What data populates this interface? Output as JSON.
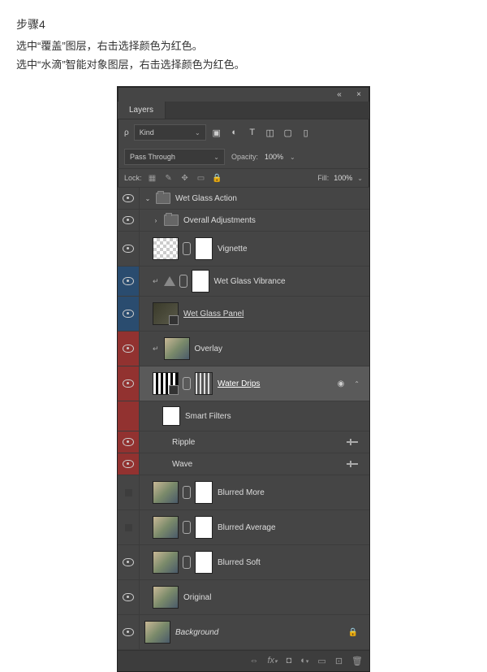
{
  "doc": {
    "step_title": "步骤4",
    "line1": "选中“覆盖”图层，右击选择颜色为红色。",
    "line2": "选中“水滴”智能对象图层，右击选择颜色为红色。"
  },
  "panel": {
    "title": "Layers",
    "filter": {
      "search_icon": "🔎",
      "kind_label": "Kind",
      "icons": [
        "image-icon",
        "adjustment-icon",
        "type-icon",
        "shape-icon",
        "smartobject-icon",
        "artboard-icon"
      ]
    },
    "blend_mode": "Pass Through",
    "opacity_label": "Opacity:",
    "opacity_value": "100%",
    "lock_label": "Lock:",
    "fill_label": "Fill:",
    "fill_value": "100%",
    "layers": {
      "group_name": "Wet Glass Action",
      "sub_group": "Overall Adjustments",
      "vignette": "Vignette",
      "vibrance": "Wet Glass Vibrance",
      "panel": "Wet Glass Panel ",
      "overlay": "Overlay",
      "water_drips": "Water Drips ",
      "smart_filters": "Smart Filters",
      "ripple": "Ripple",
      "wave": "Wave",
      "blurred_more": "Blurred More",
      "blurred_avg": "Blurred Average",
      "blurred_soft": "Blurred Soft",
      "original": "Original",
      "background": "Background"
    },
    "footer_icons": [
      "link",
      "fx",
      "mask",
      "adjustment",
      "group",
      "new",
      "trash"
    ]
  }
}
